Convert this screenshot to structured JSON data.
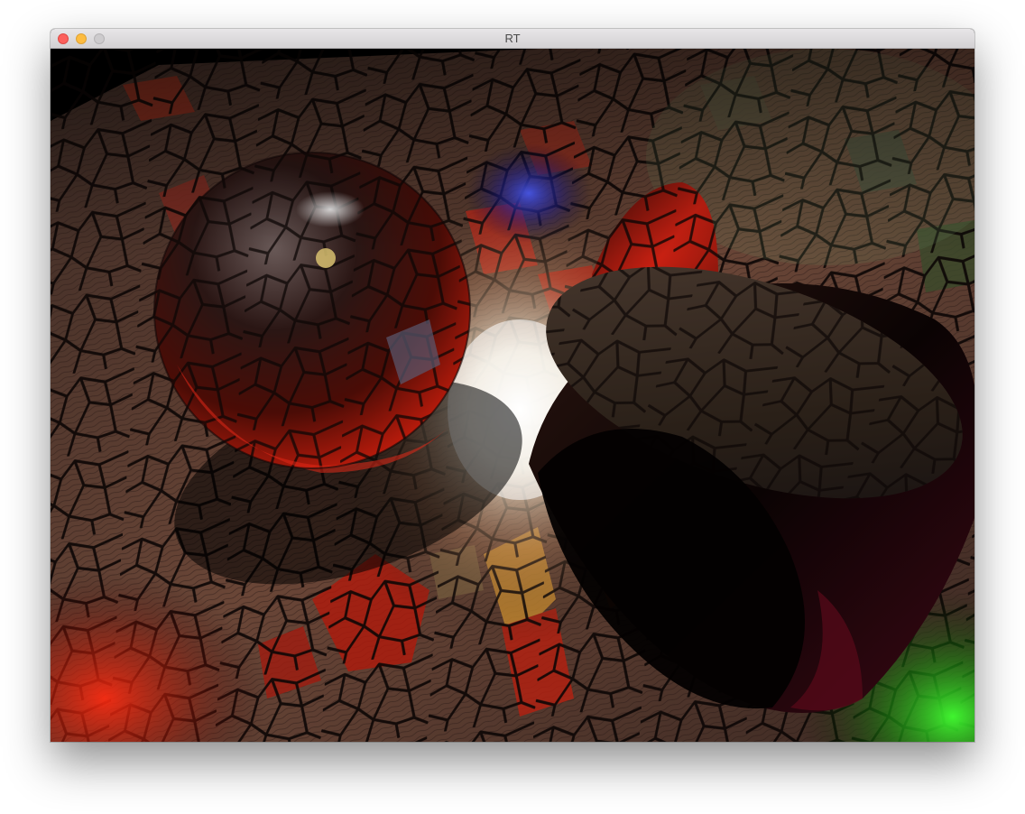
{
  "window": {
    "title": "RT"
  },
  "titlebar": {
    "buttons": [
      "close-icon",
      "minimize-icon",
      "zoom-icon"
    ],
    "colors": {
      "close": "#fc605c",
      "minimize": "#fdbc40",
      "zoom": "#cdcbcd"
    }
  },
  "render": {
    "scene": "ray-traced-scene",
    "palette": {
      "background": "#000000",
      "floor_wood": "#6a4637",
      "glass_red": "#c82012",
      "glass_amber": "#d09030",
      "light_white": "#ffffff",
      "light_blue": "#3040ff",
      "light_green": "#20e020",
      "sphere_dark": "#1a0a08"
    }
  }
}
